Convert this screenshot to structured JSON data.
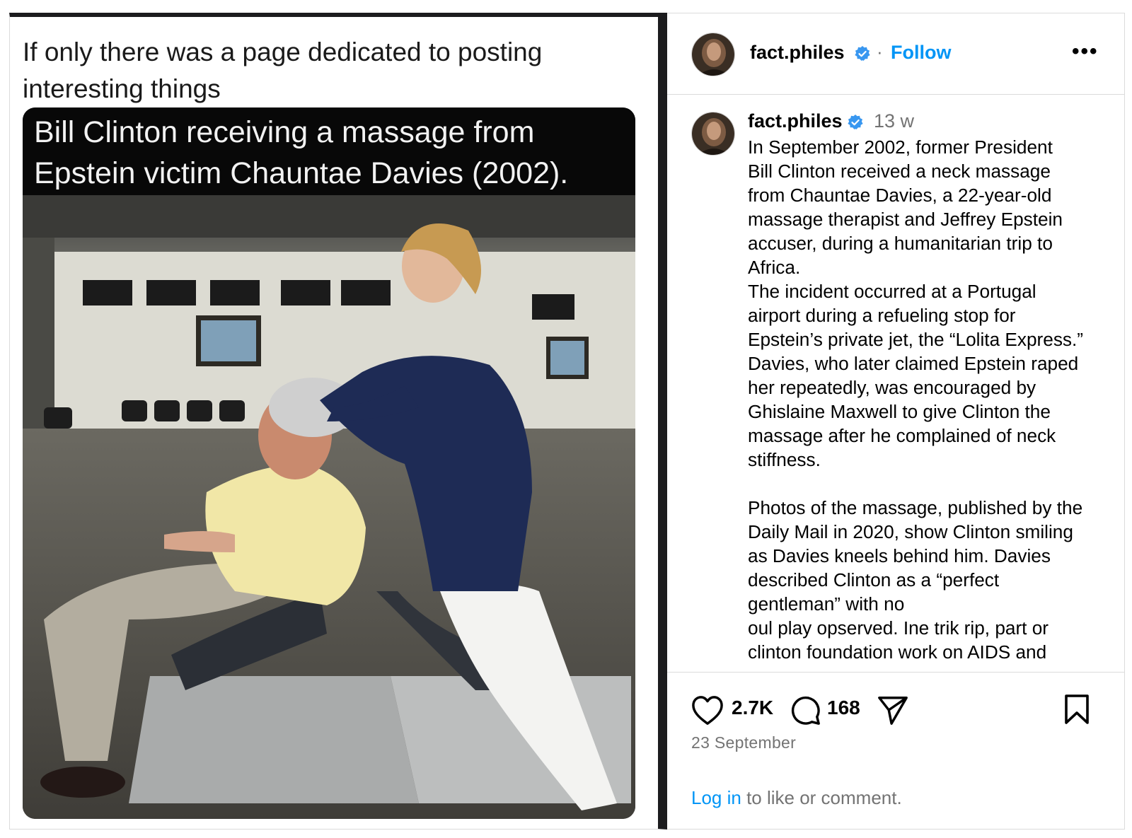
{
  "media": {
    "tweet_text": "If only there was a page dedicated to posting interesting things",
    "meme_caption": "Bill Clinton receiving a massage from Epstein victim Chauntae Davies (2002)."
  },
  "header": {
    "username": "fact.philes",
    "separator": "·",
    "follow_label": "Follow",
    "more_label": "•••"
  },
  "caption": {
    "username": "fact.philes",
    "time_ago": "13 w",
    "text": "In September 2002, former President\nBill Clinton received a neck massage\nfrom Chauntae Davies, a 22-year-old\nmassage therapist and Jeffrey Epstein\naccuser, during a humanitarian trip to\nAfrica.\nThe incident occurred at a Portugal\nairport during a refueling stop for\nEpstein’s private jet, the “Lolita Express.”\nDavies, who later claimed Epstein raped\nher repeatedly, was encouraged by\nGhislaine Maxwell to give Clinton the\nmassage after he complained of neck\nstiffness.\n\nPhotos of the massage, published by the\nDaily Mail in 2020, show Clinton smiling\nas Davies kneels behind him. Davies\ndescribed Clinton as a “perfect\ngentleman” with no\noul play opserved. Ine trik rip, part or\nclinton foundation work on AIDS and"
  },
  "actions": {
    "like_count": "2.7K",
    "comment_count": "168",
    "date": "23 September",
    "login_link": "Log in",
    "login_suffix": " to like or comment."
  },
  "colors": {
    "link_blue": "#0095f6",
    "verified_blue": "#3897f0",
    "muted_gray": "#737373",
    "divider": "#dbdbdb"
  },
  "icons": [
    "verified-badge-icon",
    "more-options-icon",
    "heart-icon",
    "comment-icon",
    "share-icon",
    "bookmark-icon"
  ]
}
